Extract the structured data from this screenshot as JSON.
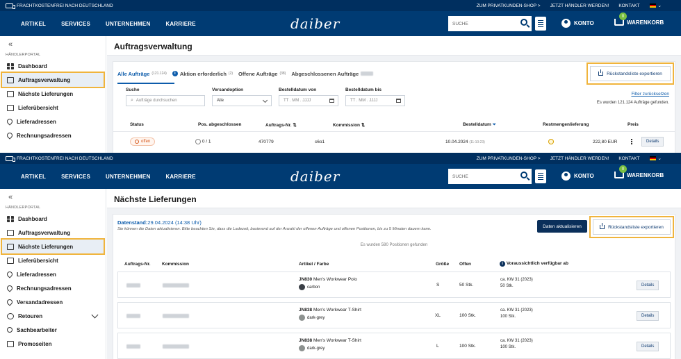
{
  "topbar": {
    "shipping": "FRACHTKOSTENFREI NACH DEUTSCHLAND",
    "links": [
      "ZUM PRIVATKUNDEN-SHOP >",
      "JETZT HÄNDLER WERDEN!",
      "KONTAKT"
    ]
  },
  "nav": {
    "menu": [
      "ARTIKEL",
      "SERVICES",
      "UNTERNEHMEN",
      "KARRIERE"
    ],
    "logo": "daiber",
    "search_placeholder": "SUCHE",
    "konto": "KONTO",
    "cart": "WARENKORB",
    "cart_count": "0"
  },
  "sidebar1": {
    "portal": "HÄNDLERPORTAL",
    "items": [
      "Dashboard",
      "Auftragsverwaltung",
      "Nächste Lieferungen",
      "Lieferübersicht",
      "Lieferadressen",
      "Rechnungsadressen"
    ]
  },
  "sidebar2": {
    "portal": "HÄNDLERPORTAL",
    "items": [
      "Dashboard",
      "Auftragsverwaltung",
      "Nächste Lieferungen",
      "Lieferübersicht",
      "Lieferadressen",
      "Rechnungsadressen",
      "Versandadressen",
      "Retouren",
      "Sachbearbeiter",
      "Promoseiten"
    ]
  },
  "orders": {
    "title": "Auftragsverwaltung",
    "tabs": [
      {
        "label": "Alle Aufträge",
        "count": "(121.124)"
      },
      {
        "label": "Aktion erforderlich",
        "count": "(2)"
      },
      {
        "label": "Offene Aufträge",
        "count": "(38)"
      },
      {
        "label": "Abgeschlossenen Aufträge",
        "count": ""
      }
    ],
    "export": "Rückstandsliste exportieren",
    "filters": {
      "search_label": "Suche",
      "search_placeholder": "Aufträge durchsuchen",
      "ship_label": "Versandoption",
      "ship_value": "Alle",
      "from_label": "Bestelldatum von",
      "to_label": "Bestelldatum bis",
      "date_placeholder": "TT . MM . JJJJ"
    },
    "reset": "Filter zurücksetzen",
    "found": "Es wurden 121.124 Aufträge gefunden.",
    "columns": [
      "Status",
      "Pos. abgeschlossen",
      "Auftrags-Nr.",
      "Kommission",
      "Bestelldatum",
      "Restmengenlieferung",
      "Preis"
    ],
    "row": {
      "status": "offen",
      "pos": "0 / 1",
      "nr": "470779",
      "kommission": "c6o1",
      "date": "10.04.2024",
      "time": "(11:10:23)",
      "price": "222,80 EUR",
      "details": "Details"
    }
  },
  "deliveries": {
    "title": "Nächste Lieferungen",
    "datenstand_label": "Datenstand:",
    "datenstand_value": "29.04.2024 (14:38 Uhr)",
    "hint": "Sie können die Daten aktualisieren. Bitte beachten Sie, dass die Ladezeit, basierend auf der Anzahl der offenen Aufträge und offenen Positionen, bis zu 5 Minuten dauern kann.",
    "refresh": "Daten aktualisieren",
    "export": "Rückstandsliste exportieren",
    "found": "Es wurden 580 Positionen gefunden",
    "columns": [
      "Auftrags-Nr.",
      "Kommission",
      "Artikel / Farbe",
      "Größe",
      "Offen",
      "Voraussichtlich verfügbar ab"
    ],
    "rows": [
      {
        "sku": "JN830",
        "name": "Men's Workwear Polo",
        "color": "carbon",
        "colorhex": "#3a3f46",
        "size": "S",
        "open": "50 Stk.",
        "avail": "ca. KW 31 (2023)",
        "qty": "50 Stk.",
        "details": "Details"
      },
      {
        "sku": "JN838",
        "name": "Men's Workwear T-Shirt",
        "color": "dark-grey",
        "colorhex": "#8c918f",
        "size": "XL",
        "open": "100 Stk.",
        "avail": "ca. KW 31 (2023)",
        "qty": "100 Stk.",
        "details": "Details"
      },
      {
        "sku": "JN838",
        "name": "Men's Workwear T-Shirt",
        "color": "dark-grey",
        "colorhex": "#8c918f",
        "size": "L",
        "open": "100 Stk.",
        "avail": "ca. KW 31 (2023)",
        "qty": "100 Stk.",
        "details": "Details"
      }
    ]
  }
}
